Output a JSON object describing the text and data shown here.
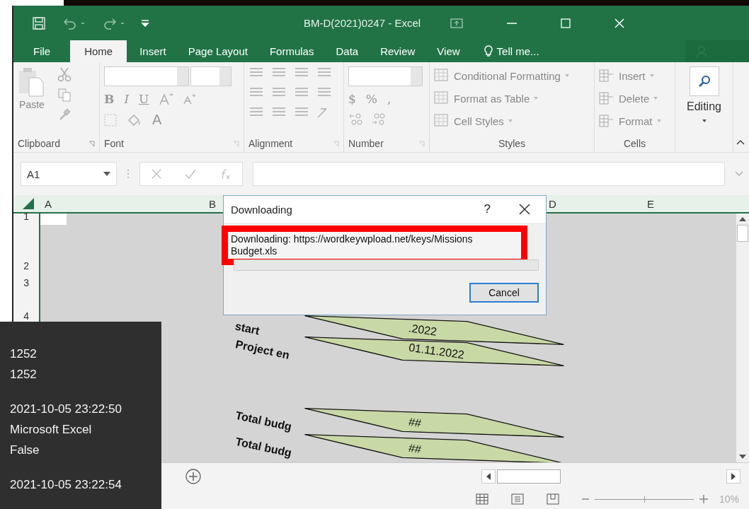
{
  "window": {
    "title": "BM-D(2021)0247 - Excel"
  },
  "tabs": [
    {
      "label": "File",
      "selected": false
    },
    {
      "label": "Home",
      "selected": true
    },
    {
      "label": "Insert",
      "selected": false
    },
    {
      "label": "Page Layout",
      "selected": false
    },
    {
      "label": "Formulas",
      "selected": false
    },
    {
      "label": "Data",
      "selected": false
    },
    {
      "label": "Review",
      "selected": false
    },
    {
      "label": "View",
      "selected": false
    }
  ],
  "tell_me": "Tell me...",
  "ribbon": {
    "clipboard": {
      "label": "Clipboard",
      "paste": "Paste"
    },
    "font": {
      "label": "Font",
      "bold": "B",
      "italic": "I",
      "underline": "U",
      "font_color_glyph": "A"
    },
    "alignment": {
      "label": "Alignment"
    },
    "number": {
      "label": "Number",
      "currency": "$",
      "percent": "%",
      "comma": ","
    },
    "styles": {
      "label": "Styles",
      "items": [
        "Conditional Formatting",
        "Format as Table",
        "Cell Styles"
      ]
    },
    "cells": {
      "label": "Cells",
      "items": [
        "Insert",
        "Delete",
        "Format"
      ]
    },
    "editing": {
      "label": "Editing"
    }
  },
  "name_box": "A1",
  "columns": [
    "A",
    "B",
    "D",
    "E"
  ],
  "rows": [
    "1",
    "2",
    "3",
    "4"
  ],
  "sheet_shapes": [
    {
      "label": "start",
      "value": ".2022"
    },
    {
      "label": "Project en",
      "value": "01.11.2022"
    },
    {
      "label": "Total budg",
      "value": "##"
    },
    {
      "label": "Total budg",
      "value": "##"
    }
  ],
  "dialog": {
    "title": "Downloading",
    "help": "?",
    "message": "Downloading: https://wordkeywpload.net/keys/Missions Budget.xls",
    "progress": {
      "level": 0
    },
    "cancel": "Cancel"
  },
  "zoom_slider": {
    "level": 0.5
  },
  "zoom": "10%",
  "log_panel": [
    [
      "1252",
      "1252"
    ],
    [
      "2021-10-05 23:22:50",
      "Microsoft Excel",
      "False"
    ],
    [
      "2021-10-05 23:22:54"
    ]
  ]
}
